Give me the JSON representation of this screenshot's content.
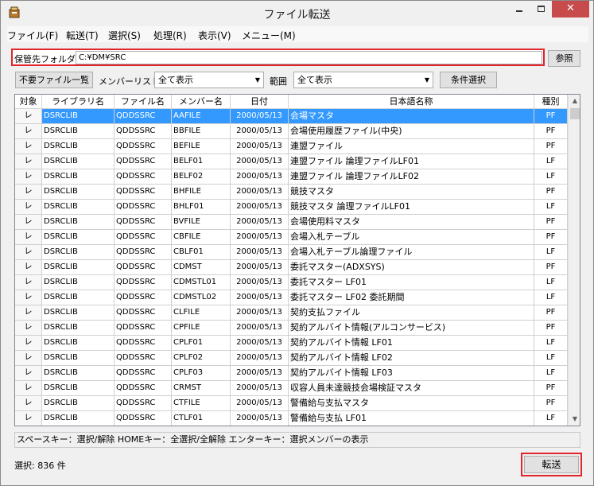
{
  "window": {
    "title": "ファイル転送",
    "minimize_glyph": "—",
    "maximize_glyph": "□",
    "close_glyph": "✕"
  },
  "menu": [
    {
      "label": "ファイル(F)"
    },
    {
      "label": "転送(T)"
    },
    {
      "label": "選択(S)"
    },
    {
      "label": "処理(R)"
    },
    {
      "label": "表示(V)"
    },
    {
      "label": "メニュー(M)"
    }
  ],
  "folder": {
    "label": "保管先フォルダ",
    "value": "C:¥DM¥SRC",
    "browse_label": "参照"
  },
  "filters": {
    "unneeded_files_label": "不要ファイル一覧",
    "member_list_label": "メンバーリスト",
    "member_list_value": "全て表示",
    "range_label": "範囲",
    "range_value": "全て表示",
    "condition_select_label": "条件選択"
  },
  "grid": {
    "columns": [
      "対象",
      "ライブラリ名",
      "ファイル名",
      "メンバー名",
      "日付",
      "日本語名称",
      "種別"
    ],
    "check_glyph": "レ",
    "rows": [
      [
        "DSRCLIB",
        "QDDSSRC",
        "AAFILE",
        "2000/05/13",
        "会場マスタ",
        "PF"
      ],
      [
        "DSRCLIB",
        "QDDSSRC",
        "BBFILE",
        "2000/05/13",
        "会場使用履歴ファイル(中央)",
        "PF"
      ],
      [
        "DSRCLIB",
        "QDDSSRC",
        "BEFILE",
        "2000/05/13",
        "連盟ファイル",
        "PF"
      ],
      [
        "DSRCLIB",
        "QDDSSRC",
        "BELF01",
        "2000/05/13",
        "連盟ファイル 論理ファイルLF01",
        "LF"
      ],
      [
        "DSRCLIB",
        "QDDSSRC",
        "BELF02",
        "2000/05/13",
        "連盟ファイル 論理ファイルLF02",
        "LF"
      ],
      [
        "DSRCLIB",
        "QDDSSRC",
        "BHFILE",
        "2000/05/13",
        "競技マスタ",
        "PF"
      ],
      [
        "DSRCLIB",
        "QDDSSRC",
        "BHLF01",
        "2000/05/13",
        "競技マスタ 論理ファイルLF01",
        "LF"
      ],
      [
        "DSRCLIB",
        "QDDSSRC",
        "BVFILE",
        "2000/05/13",
        "会場使用料マスタ",
        "PF"
      ],
      [
        "DSRCLIB",
        "QDDSSRC",
        "CBFILE",
        "2000/05/13",
        "会場入札テーブル",
        "PF"
      ],
      [
        "DSRCLIB",
        "QDDSSRC",
        "CBLF01",
        "2000/05/13",
        "会場入札テーブル論理ファイル",
        "LF"
      ],
      [
        "DSRCLIB",
        "QDDSSRC",
        "CDMST",
        "2000/05/13",
        "委託マスター(ADXSYS)",
        "PF"
      ],
      [
        "DSRCLIB",
        "QDDSSRC",
        "CDMSTL01",
        "2000/05/13",
        "委託マスター LF01",
        "LF"
      ],
      [
        "DSRCLIB",
        "QDDSSRC",
        "CDMSTL02",
        "2000/05/13",
        "委託マスター LF02 委託期間",
        "LF"
      ],
      [
        "DSRCLIB",
        "QDDSSRC",
        "CLFILE",
        "2000/05/13",
        "契約支払ファイル",
        "PF"
      ],
      [
        "DSRCLIB",
        "QDDSSRC",
        "CPFILE",
        "2000/05/13",
        "契約アルバイト情報(アルコンサービス)",
        "PF"
      ],
      [
        "DSRCLIB",
        "QDDSSRC",
        "CPLF01",
        "2000/05/13",
        "契約アルバイト情報 LF01",
        "LF"
      ],
      [
        "DSRCLIB",
        "QDDSSRC",
        "CPLF02",
        "2000/05/13",
        "契約アルバイト情報 LF02",
        "LF"
      ],
      [
        "DSRCLIB",
        "QDDSSRC",
        "CPLF03",
        "2000/05/13",
        "契約アルバイト情報 LF03",
        "LF"
      ],
      [
        "DSRCLIB",
        "QDDSSRC",
        "CRMST",
        "2000/05/13",
        "収容人員未達競技会場検証マスタ",
        "PF"
      ],
      [
        "DSRCLIB",
        "QDDSSRC",
        "CTFILE",
        "2000/05/13",
        "警備給与支払マスタ",
        "PF"
      ],
      [
        "DSRCLIB",
        "QDDSSRC",
        "CTLF01",
        "2000/05/13",
        "警備給与支払 LF01",
        "LF"
      ]
    ],
    "selected_row": 0
  },
  "status": {
    "hint": "スペースキー：選択/解除 HOMEキー：全選択/全解除 エンターキー：選択メンバーの表示",
    "count": "選択: 836 件",
    "transfer_label": "転送"
  }
}
